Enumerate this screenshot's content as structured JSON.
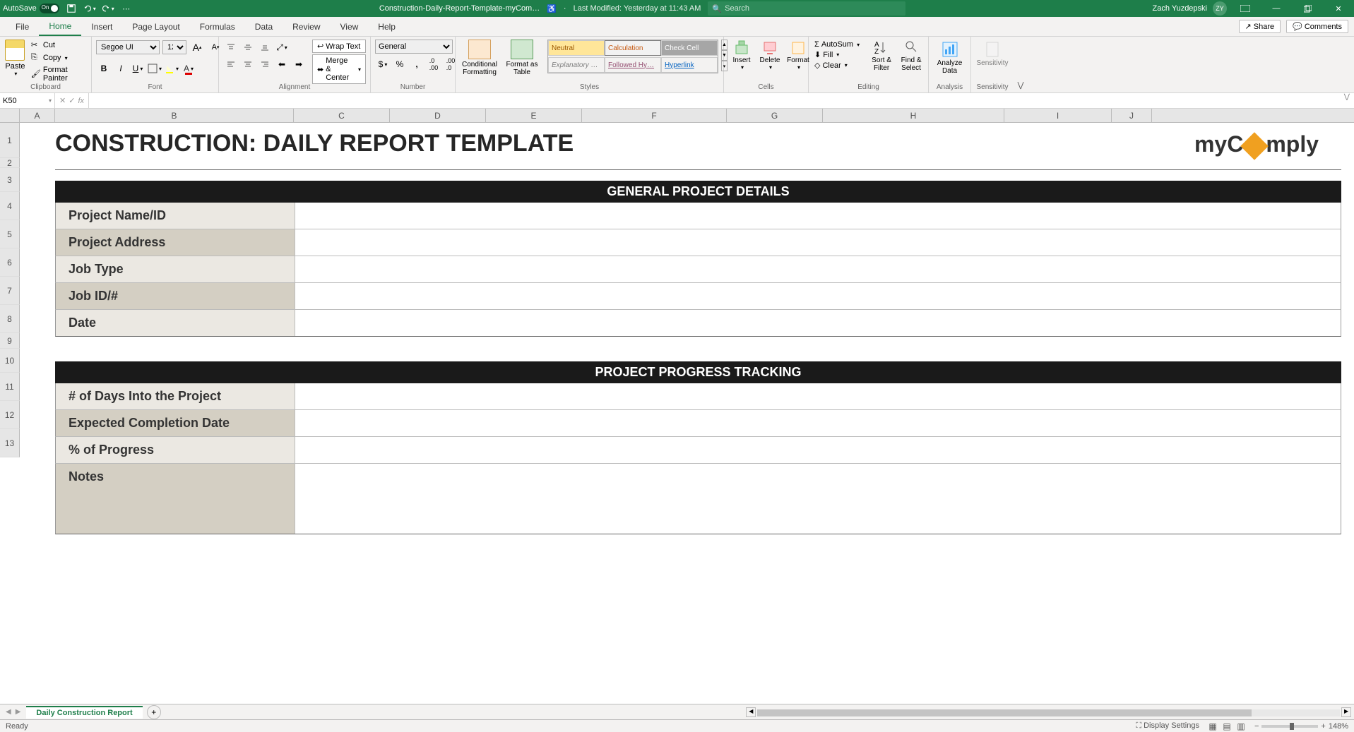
{
  "titlebar": {
    "autosave_label": "AutoSave",
    "autosave_state": "On",
    "doc_title": "Construction-Daily-Report-Template-myCom…",
    "save_info": "Last Modified: Yesterday at 11:43 AM",
    "search_placeholder": "Search",
    "user_name": "Zach Yuzdepski",
    "user_initials": "ZY"
  },
  "tabs": [
    "File",
    "Home",
    "Insert",
    "Page Layout",
    "Formulas",
    "Data",
    "Review",
    "View",
    "Help"
  ],
  "active_tab": "Home",
  "tab_actions": {
    "share": "Share",
    "comments": "Comments"
  },
  "ribbon": {
    "clipboard": {
      "paste": "Paste",
      "cut": "Cut",
      "copy": "Copy",
      "painter": "Format Painter",
      "label": "Clipboard"
    },
    "font": {
      "name": "Segoe UI",
      "size": "12",
      "label": "Font",
      "increase": "A",
      "decrease": "A",
      "bold": "B",
      "italic": "I",
      "underline": "U"
    },
    "alignment": {
      "wrap": "Wrap Text",
      "merge": "Merge & Center",
      "label": "Alignment"
    },
    "number": {
      "format": "General",
      "currency": "$",
      "percent": "%",
      "comma": ",",
      "inc": ".00",
      "dec": ".00",
      "label": "Number"
    },
    "styles": {
      "cond": "Conditional Formatting",
      "table": "Format as Table",
      "neutral": "Neutral",
      "calc": "Calculation",
      "check": "Check Cell",
      "explan": "Explanatory …",
      "followed": "Followed Hy…",
      "hyper": "Hyperlink",
      "label": "Styles"
    },
    "cells": {
      "insert": "Insert",
      "delete": "Delete",
      "format": "Format",
      "label": "Cells"
    },
    "editing": {
      "autosum": "AutoSum",
      "fill": "Fill",
      "clear": "Clear",
      "sort": "Sort & Filter",
      "find": "Find & Select",
      "label": "Editing"
    },
    "analysis": {
      "analyze": "Analyze Data",
      "label": "Analysis"
    },
    "sensitivity": {
      "btn": "Sensitivity",
      "label": "Sensitivity"
    }
  },
  "name_box": "K50",
  "columns": [
    "A",
    "B",
    "C",
    "D",
    "E",
    "F",
    "G",
    "H",
    "I",
    "J"
  ],
  "rows": [
    "1",
    "2",
    "3",
    "4",
    "5",
    "6",
    "7",
    "8",
    "9",
    "10",
    "11",
    "12",
    "13"
  ],
  "template": {
    "title": "CONSTRUCTION: DAILY REPORT TEMPLATE",
    "logo_pre": "myC",
    "logo_post": "mply",
    "section1": {
      "header": "GENERAL PROJECT DETAILS",
      "rows": [
        "Project Name/ID",
        "Project Address",
        "Job Type",
        "Job ID/#",
        "Date"
      ]
    },
    "section2": {
      "header": "PROJECT PROGRESS TRACKING",
      "rows": [
        "# of Days Into the Project",
        "Expected Completion Date",
        "% of Progress",
        "Notes"
      ]
    }
  },
  "sheet_tab": "Daily Construction Report",
  "statusbar": {
    "ready": "Ready",
    "display": "Display Settings",
    "zoom": "148%"
  }
}
